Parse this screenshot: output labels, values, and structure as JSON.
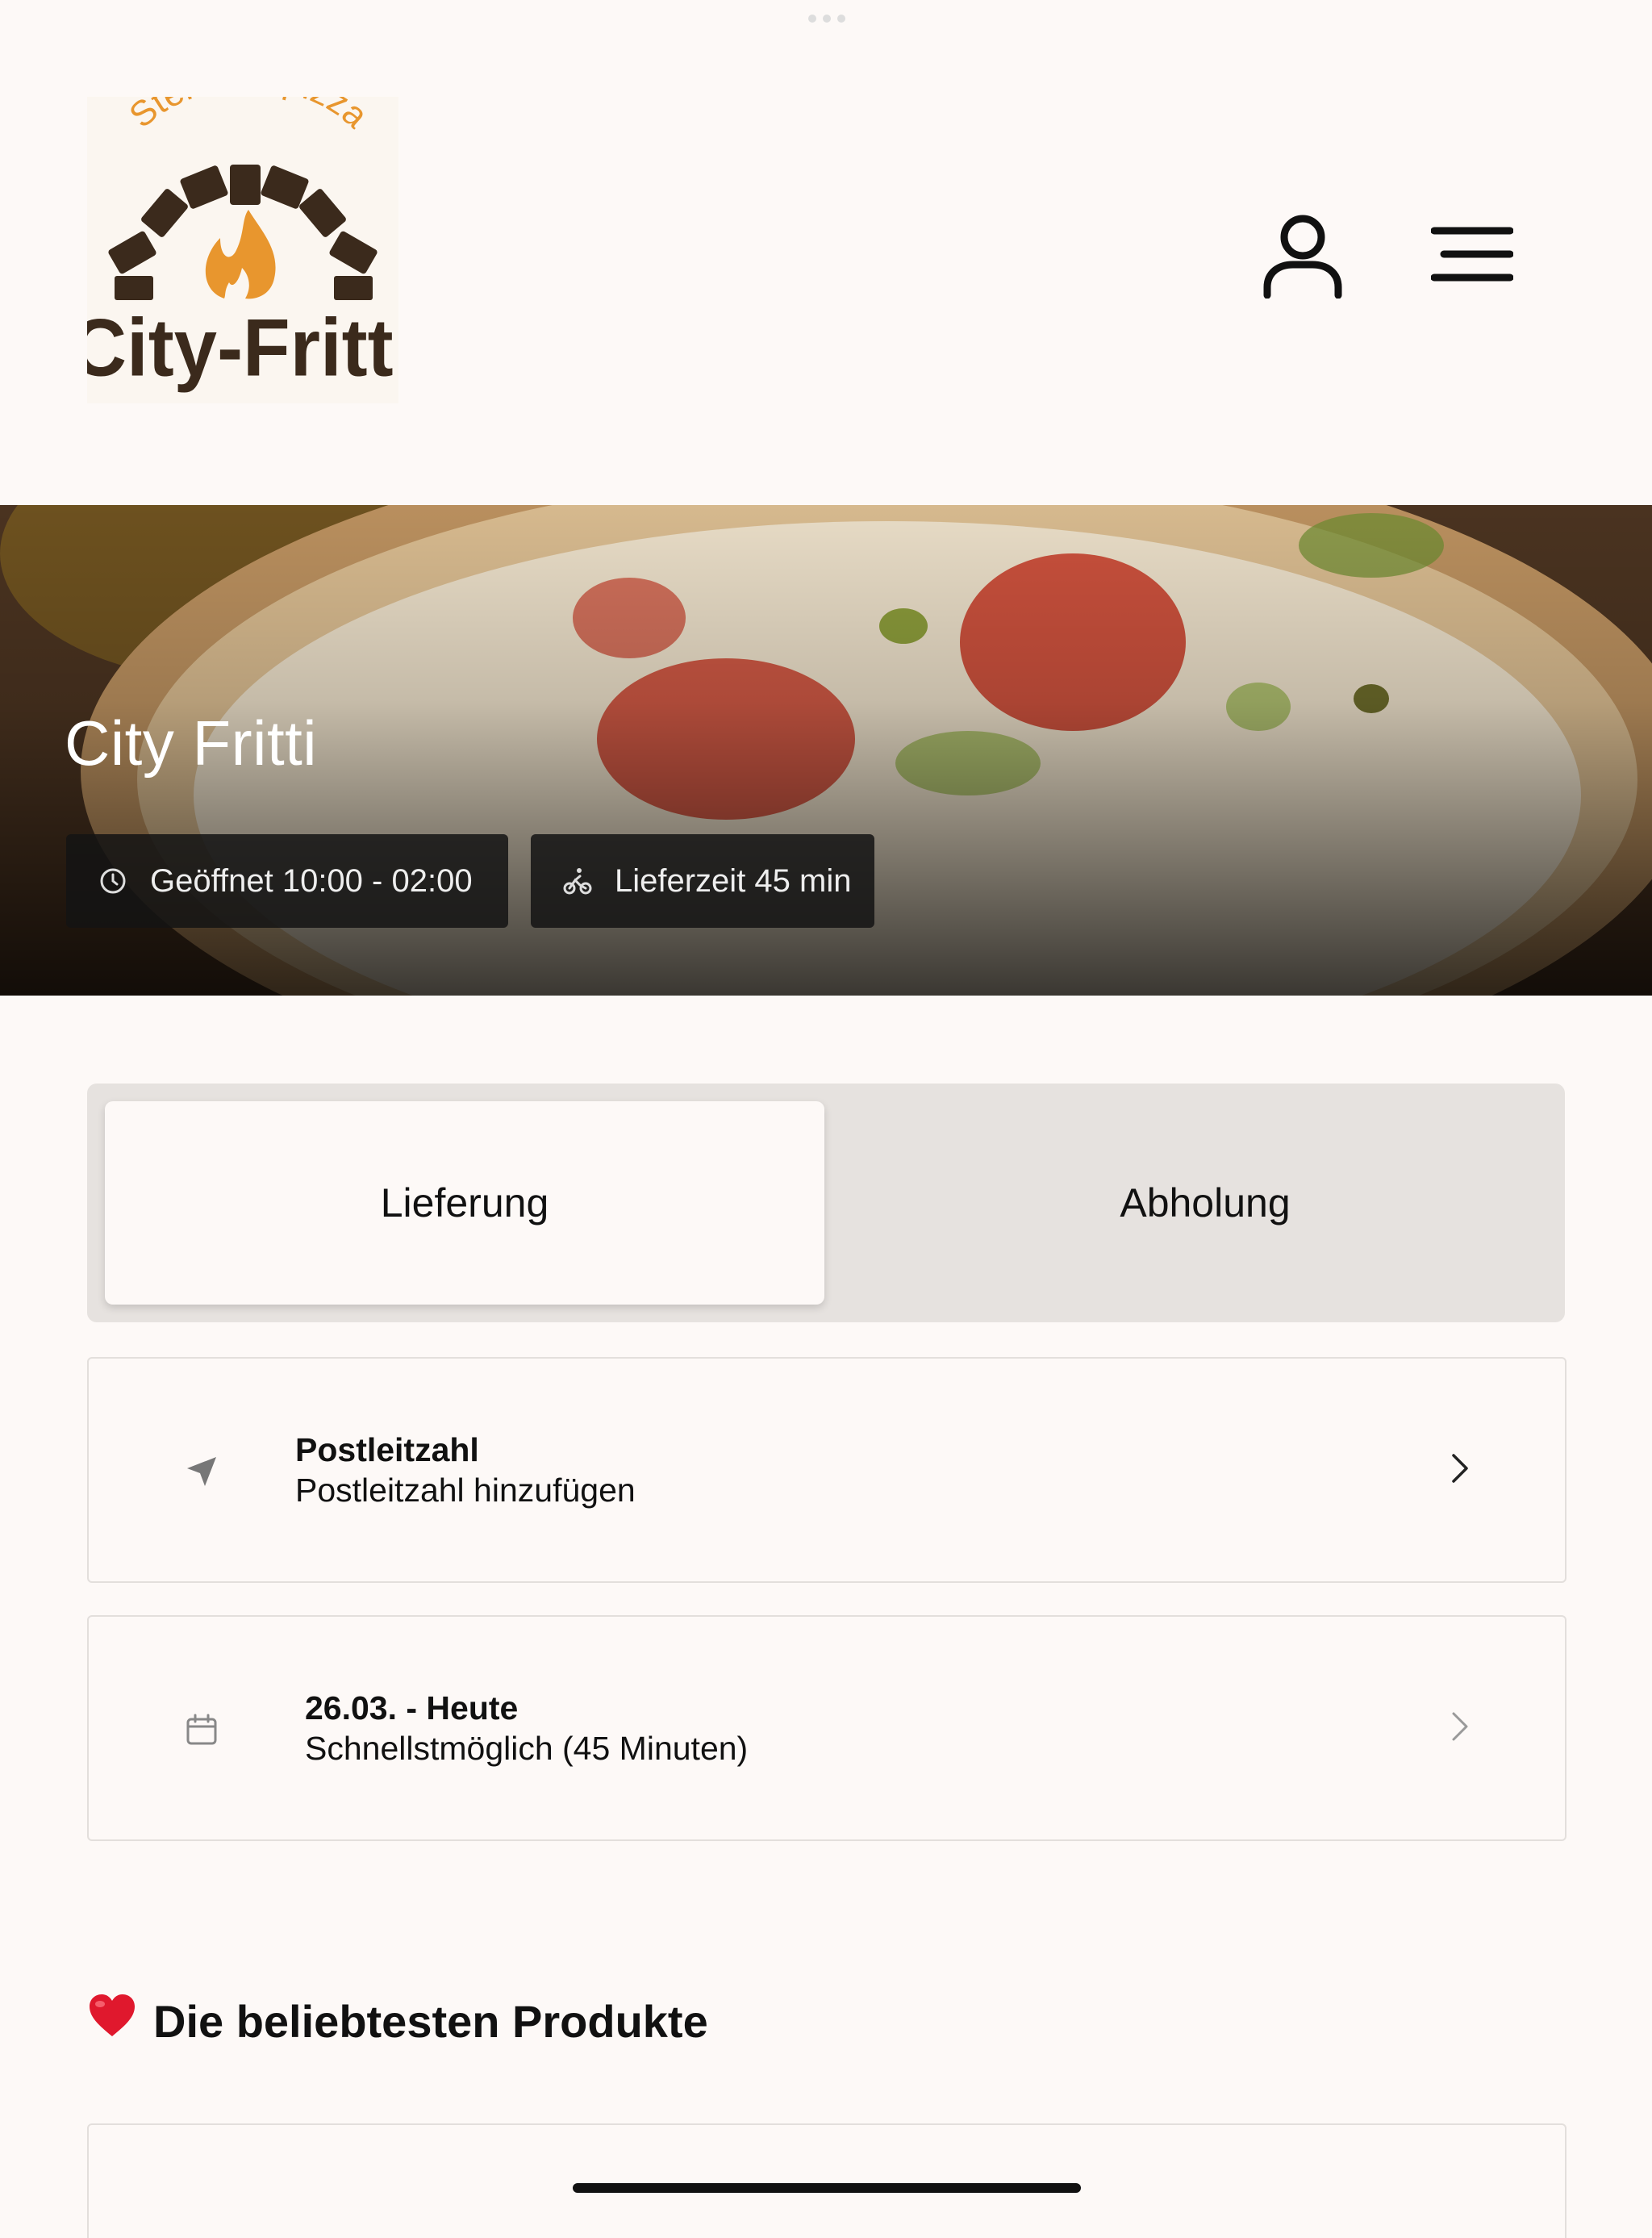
{
  "header": {
    "logo": {
      "arc_text": "Steinofenpizza",
      "name": "City-Fritti"
    },
    "user_icon": "user-icon",
    "menu_icon": "hamburger-menu-icon"
  },
  "hero": {
    "title": "City Fritti",
    "hours_label": "Geöffnet 10:00 - 02:00",
    "delivery_label": "Lieferzeit 45 min"
  },
  "mode_toggle": {
    "options": [
      {
        "label": "Lieferung",
        "selected": true
      },
      {
        "label": "Abholung",
        "selected": false
      }
    ]
  },
  "zip_card": {
    "title": "Postleitzahl",
    "subtitle": "Postleitzahl hinzufügen",
    "icon": "location-arrow-icon"
  },
  "date_card": {
    "title": "26.03. - Heute",
    "subtitle": "Schnellstmöglich (45 Minuten)",
    "icon": "calendar-icon"
  },
  "popular": {
    "emoji": "❤️",
    "title": "Die beliebtesten Produkte"
  },
  "colors": {
    "background": "#fdf9f7",
    "logo_brown": "#3b2a1c",
    "logo_orange": "#e8962e",
    "chip_bg": "#1a1a1a"
  }
}
